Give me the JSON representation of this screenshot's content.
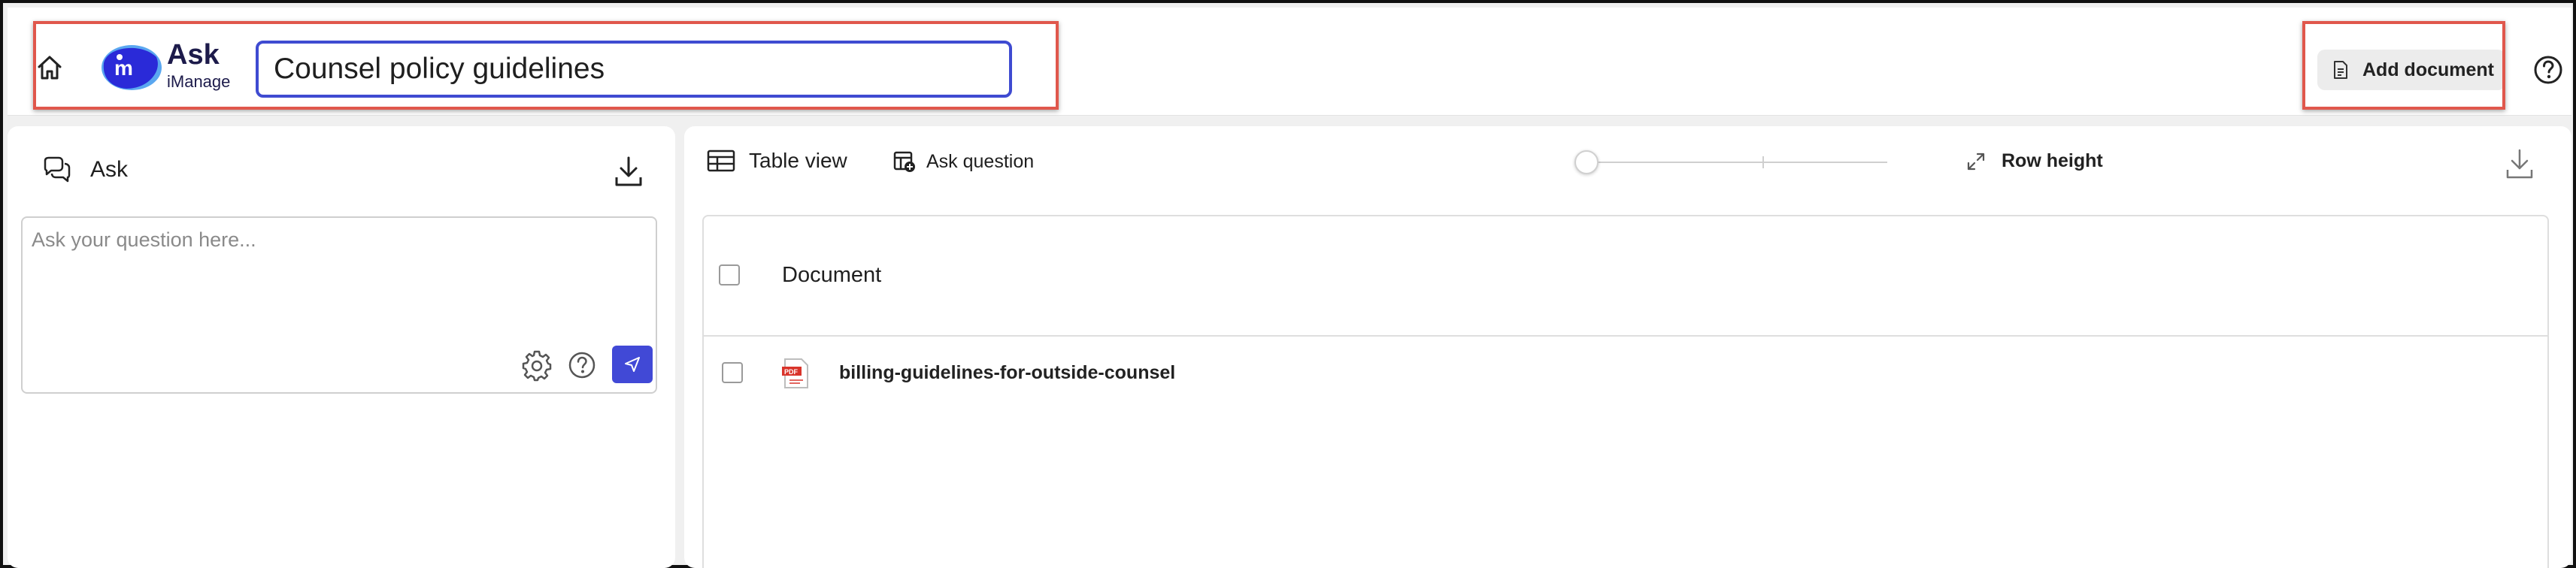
{
  "app": {
    "brand_main": "Ask",
    "brand_sub": "iManage"
  },
  "header": {
    "title_value": "Counsel policy guidelines",
    "add_document_label": "Add document"
  },
  "ask_panel": {
    "title": "Ask",
    "placeholder": "Ask your question here..."
  },
  "toolbar": {
    "table_view_label": "Table view",
    "ask_question_label": "Ask question",
    "row_height_label": "Row height",
    "row_height_level": 0
  },
  "table": {
    "header_document": "Document",
    "rows": [
      {
        "name": "billing-guidelines-for-outside-counsel",
        "type": "PDF"
      }
    ]
  },
  "colors": {
    "accent": "#4149d6",
    "highlight": "#e0574c",
    "brand_blue": "#2a2ad8"
  }
}
